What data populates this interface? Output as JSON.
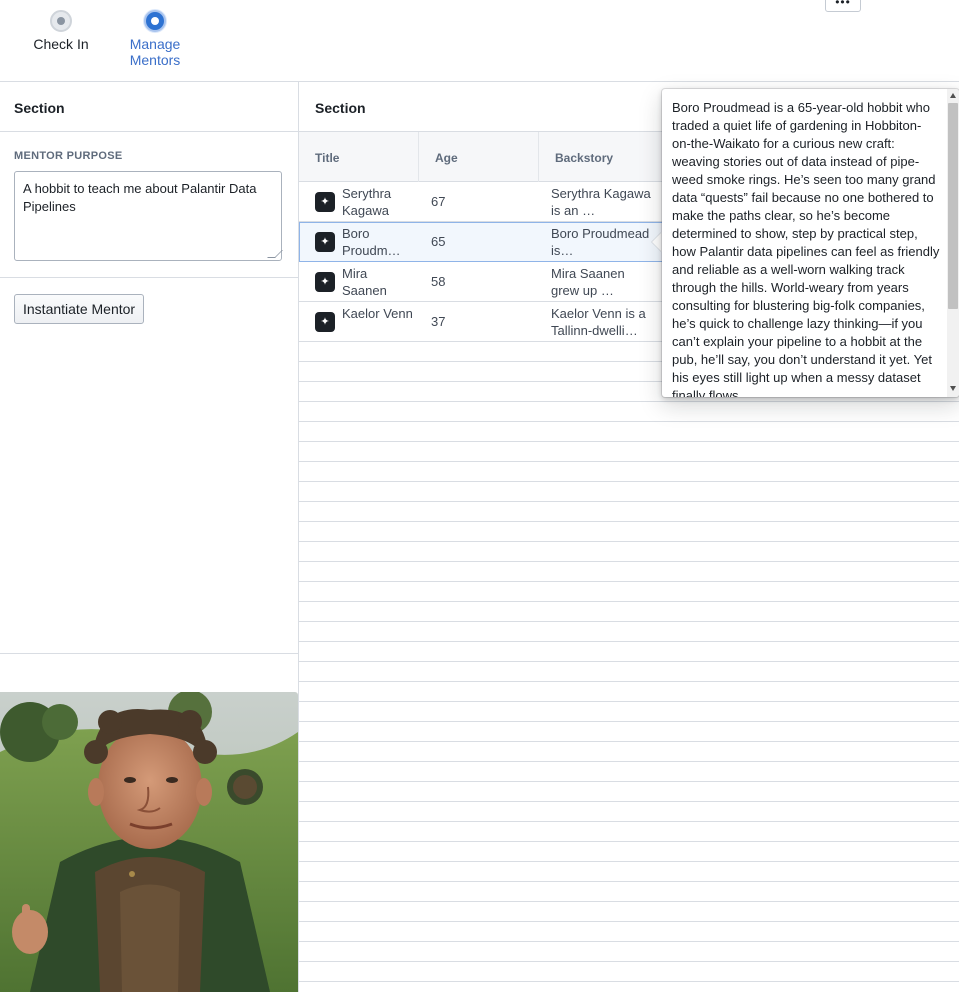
{
  "steps": [
    {
      "label": "Check In",
      "state": "inactive"
    },
    {
      "label": "Manage Mentors",
      "state": "active"
    }
  ],
  "more_button": {
    "label": "•••"
  },
  "left_panel": {
    "section_title": "Section",
    "purpose_label": "MENTOR PURPOSE",
    "purpose_value": "A hobbit to teach me about Palantir Data Pipelines",
    "instantiate_button": "Instantiate Mentor"
  },
  "right_panel": {
    "section_title": "Section",
    "columns": [
      "Title",
      "Age",
      "Backstory"
    ],
    "rows": [
      {
        "title": "Serythra Kagawa",
        "age": "67",
        "backstory": "Serythra Kagawa is an …"
      },
      {
        "title": "Boro Proudm…",
        "age": "65",
        "backstory": "Boro Proudmead is…",
        "selected": true
      },
      {
        "title": "Mira Saanen",
        "age": "58",
        "backstory": "Mira Saanen grew up …"
      },
      {
        "title": "Kaelor Venn",
        "age": "37",
        "backstory": "Kaelor Venn is a Tallinn-dwelli…"
      }
    ]
  },
  "popover": {
    "text": "Boro Proudmead is a 65-year-old hobbit who traded a quiet life of gardening in Hobbiton-on-the-Waikato for a curious new craft: weaving stories out of data instead of pipe-weed smoke rings. He’s seen too many grand data “quests” fail because no one bothered to make the paths clear, so he’s become determined to show, step by practical step, how Palantir data pipelines can feel as friendly and reliable as a well-worn walking track through the hills. World-weary from years consulting for blustering big-folk companies, he’s quick to challenge lazy thinking—if you can’t explain your pipeline to a hobbit at the pub, he’ll say, you don’t understand it yet. Yet his eyes still light up when a messy dataset finally flows"
  },
  "colors": {
    "accent": "#2d72d2",
    "border": "#d9dde3",
    "text": "#1c2127",
    "muted": "#5f6b7c"
  },
  "icons": [
    "mentor-avatar-icon",
    "more-options-icon",
    "resize-handle-icon"
  ]
}
